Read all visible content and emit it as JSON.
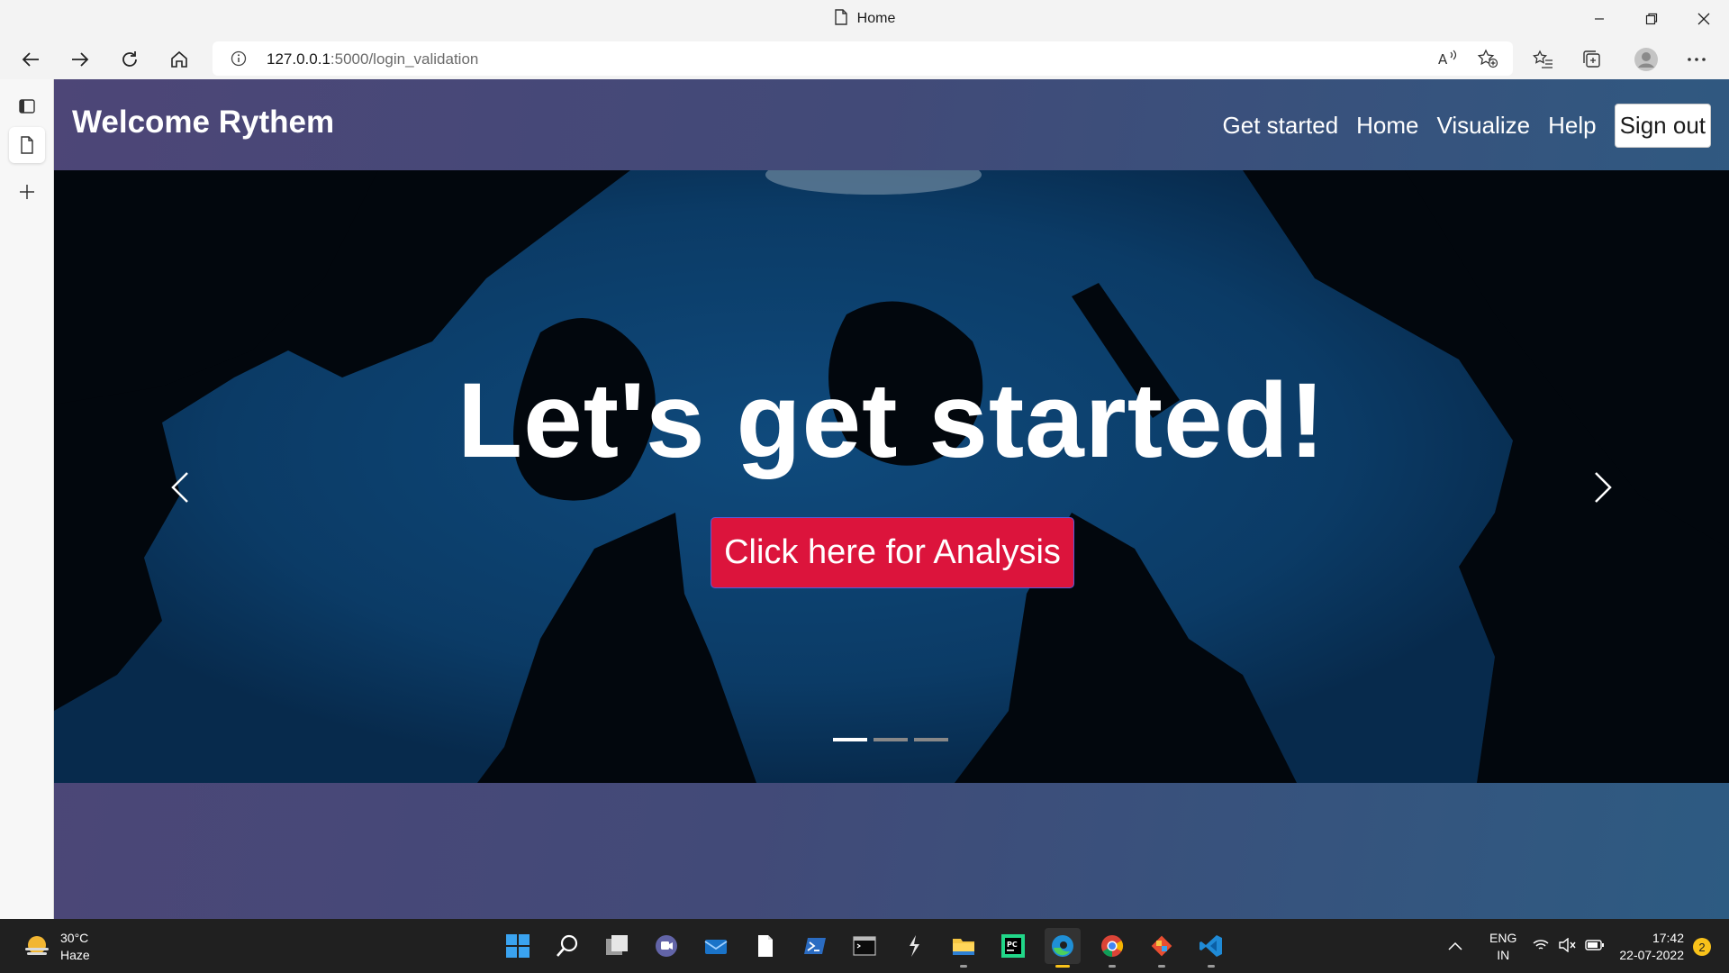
{
  "browser": {
    "tab_title": "Home",
    "url_host": "127.0.0.1",
    "url_path": ":5000/login_validation"
  },
  "site": {
    "brand": "Welcome Rythem",
    "nav": [
      "Get started",
      "Home",
      "Visualize",
      "Help"
    ],
    "signout": "Sign out"
  },
  "hero": {
    "title": "Let's get started!",
    "button": "Click here for Analysis",
    "slides": 3,
    "active_slide": 0
  },
  "taskbar": {
    "temperature": "30°C",
    "weather": "Haze",
    "lang_line1": "ENG",
    "lang_line2": "IN",
    "time": "17:42",
    "date": "22-07-2022",
    "notifications": "2"
  },
  "colors": {
    "accent_button": "#dc143c",
    "nav_gradient_start": "#4d4677",
    "nav_gradient_end": "#2d5b82"
  }
}
